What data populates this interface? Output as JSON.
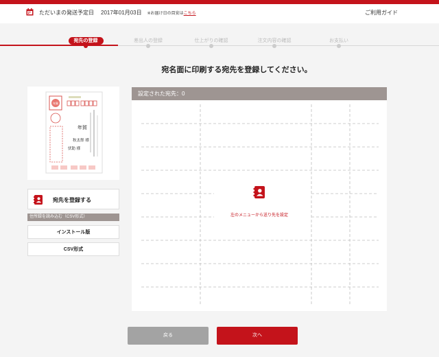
{
  "topbar": {
    "shipping_label": "ただいまの発送予定日",
    "shipping_date": "2017年01月03日",
    "note": "※お届け日の目安は",
    "note_link": "こちら",
    "guide_link": "ご利用ガイド",
    "calendar_icon": "calendar-icon"
  },
  "steps": [
    {
      "label": "宛先の登録",
      "active": true
    },
    {
      "label": "差出人の登録",
      "active": false
    },
    {
      "label": "仕上がりの確認",
      "active": false
    },
    {
      "label": "注文内容の確認",
      "active": false
    },
    {
      "label": "お支払い",
      "active": false
    }
  ],
  "heading": "宛名面に印刷する宛先を登録してください。",
  "preview": {
    "recipient": "秋太郎 様",
    "recipient2": "伏助 様",
    "greeting": "年賀"
  },
  "sidebar": {
    "register_label": "宛先を登録する",
    "register_icon": "address-book-icon",
    "csv_header": "住所録を読み込む（CSV形式）",
    "install_label": "インストール版",
    "csv_label": "CSV形式"
  },
  "panel": {
    "header": "設定された宛先：0",
    "empty_message": "左のメニューから送り先を設定",
    "empty_icon": "address-book-icon"
  },
  "footer": {
    "back_label": "戻る",
    "next_label": "次へ"
  },
  "colors": {
    "accent": "#c4131b",
    "header_gray": "#9e9592",
    "button_gray": "#a3a3a3"
  }
}
